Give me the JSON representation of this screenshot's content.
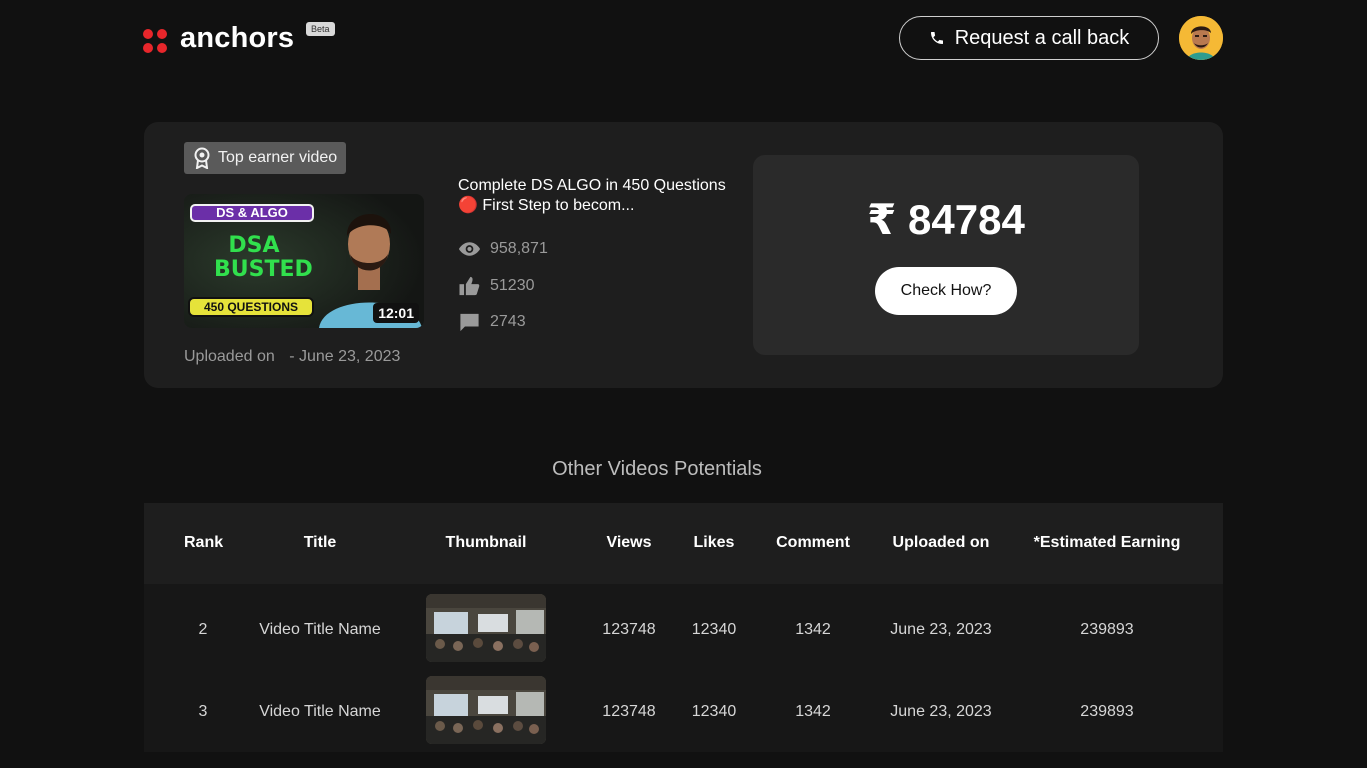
{
  "header": {
    "logo_text": "anchors",
    "beta_label": "Beta",
    "callback_label": "Request a call back"
  },
  "top_video": {
    "badge_label": "Top earner video",
    "thumbnail": {
      "tag": "DS & ALGO",
      "headline_1": "DSA",
      "headline_2": "BUSTED",
      "questions": "450 QUESTIONS",
      "duration": "12:01"
    },
    "title": "Complete DS ALGO in 450 Questions 🔴 First Step to becom...",
    "views": "958,871",
    "likes": "51230",
    "comments": "2743",
    "uploaded_label": "Uploaded on",
    "uploaded_date": "- June 23, 2023",
    "earning": "₹ 84784",
    "check_label": "Check How?"
  },
  "section_title": "Other Videos Potentials",
  "table": {
    "headers": [
      "Rank",
      "Title",
      "Thumbnail",
      "Views",
      "Likes",
      "Comment",
      "Uploaded on",
      "*Estimated Earning"
    ],
    "rows": [
      {
        "rank": "2",
        "title": "Video Title Name",
        "views": "123748",
        "likes": "12340",
        "comment": "1342",
        "uploaded": "June 23, 2023",
        "earning": "239893"
      },
      {
        "rank": "3",
        "title": "Video Title Name",
        "views": "123748",
        "likes": "12340",
        "comment": "1342",
        "uploaded": "June 23, 2023",
        "earning": "239893"
      }
    ]
  },
  "colors": {
    "background": "#111111",
    "card": "#1e1e1e",
    "logo_red": "#e8262b",
    "earn_box": "#2a2a2a"
  },
  "icons": [
    "phone-icon",
    "award-icon",
    "eye-icon",
    "thumbs-up-icon",
    "comment-icon"
  ]
}
